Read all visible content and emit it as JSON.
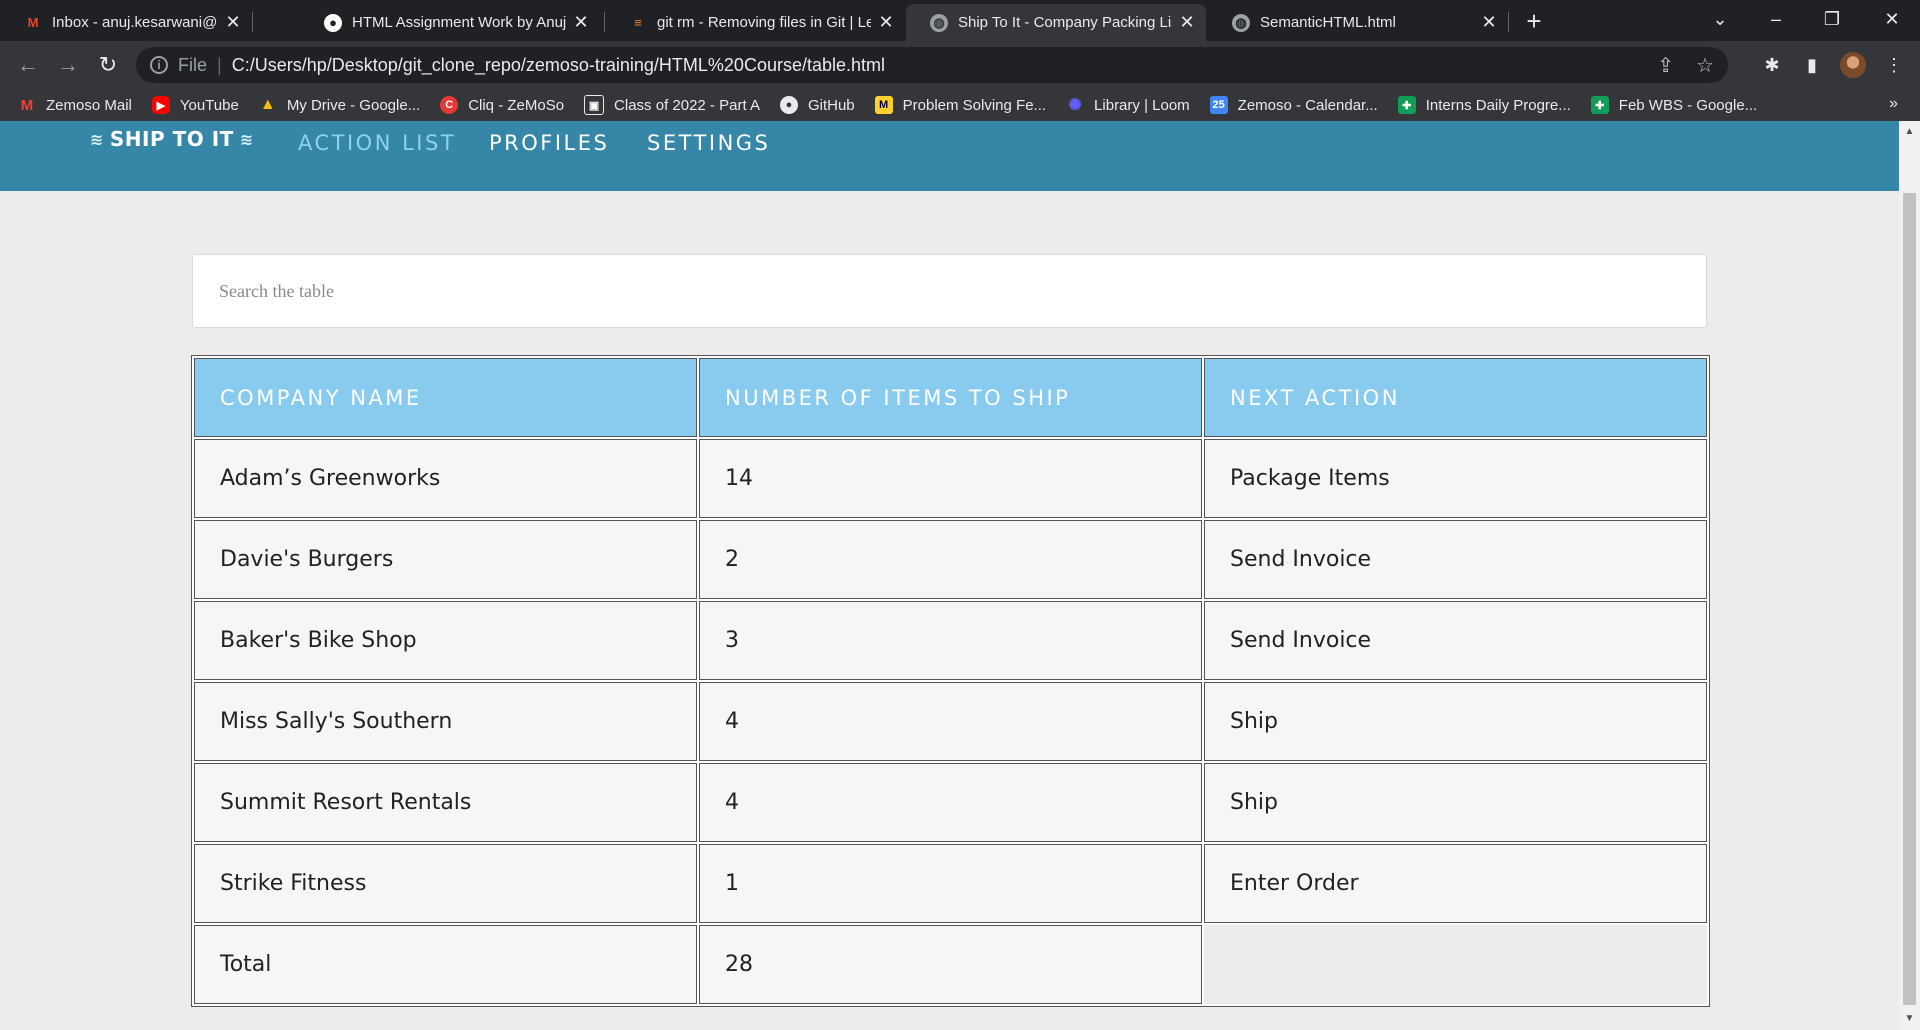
{
  "browser": {
    "tabs": [
      {
        "title": "Inbox - anuj.kesarwani@zemosol",
        "icon": "gmail-icon"
      },
      {
        "title": "HTML Assignment Work by Anuj",
        "icon": "github-icon"
      },
      {
        "title": "git rm - Removing files in Git | Le",
        "icon": "stack-overflow-icon"
      },
      {
        "title": "Ship To It - Company Packing List",
        "icon": "globe-icon",
        "active": true
      },
      {
        "title": "SemanticHTML.html",
        "icon": "globe-icon"
      }
    ],
    "address": {
      "scheme_label": "File",
      "url": "C:/Users/hp/Desktop/git_clone_repo/zemoso-training/HTML%20Course/table.html"
    },
    "bookmarks": [
      {
        "label": "Zemoso Mail",
        "icon": "gmail-icon"
      },
      {
        "label": "YouTube",
        "icon": "youtube-icon"
      },
      {
        "label": "My Drive - Google...",
        "icon": "drive-icon"
      },
      {
        "label": "Cliq - ZeMoSo",
        "icon": "cliq-icon"
      },
      {
        "label": "Class of 2022 - Part A",
        "icon": "classroom-icon"
      },
      {
        "label": "GitHub",
        "icon": "github-icon"
      },
      {
        "label": "Problem Solving Fe...",
        "icon": "miro-icon"
      },
      {
        "label": "Library | Loom",
        "icon": "loom-icon"
      },
      {
        "label": "Zemoso - Calendar...",
        "icon": "calendar-icon"
      },
      {
        "label": "Interns Daily Progre...",
        "icon": "sheets-icon"
      },
      {
        "label": "Feb WBS - Google...",
        "icon": "sheets-icon"
      }
    ],
    "bookmarks_more": "»"
  },
  "site": {
    "logo_text": "SHIP TO IT",
    "nav": [
      {
        "label": "ACTION LIST",
        "current": true
      },
      {
        "label": "PROFILES"
      },
      {
        "label": "SETTINGS"
      }
    ],
    "search_placeholder": "Search the table"
  },
  "table": {
    "headers": [
      "COMPANY NAME",
      "NUMBER OF ITEMS TO SHIP",
      "NEXT ACTION"
    ],
    "rows": [
      [
        "Adam’s Greenworks",
        "14",
        "Package Items"
      ],
      [
        "Davie's Burgers",
        "2",
        "Send Invoice"
      ],
      [
        "Baker's Bike Shop",
        "3",
        "Send Invoice"
      ],
      [
        "Miss Sally's Southern",
        "4",
        "Ship"
      ],
      [
        "Summit Resort Rentals",
        "4",
        "Ship"
      ],
      [
        "Strike Fitness",
        "1",
        "Enter Order"
      ]
    ],
    "footer": [
      "Total",
      "28"
    ]
  },
  "colors": {
    "header_bar": "#3687a7",
    "table_header": "#88cbef",
    "nav_current": "#8fd0f0"
  }
}
